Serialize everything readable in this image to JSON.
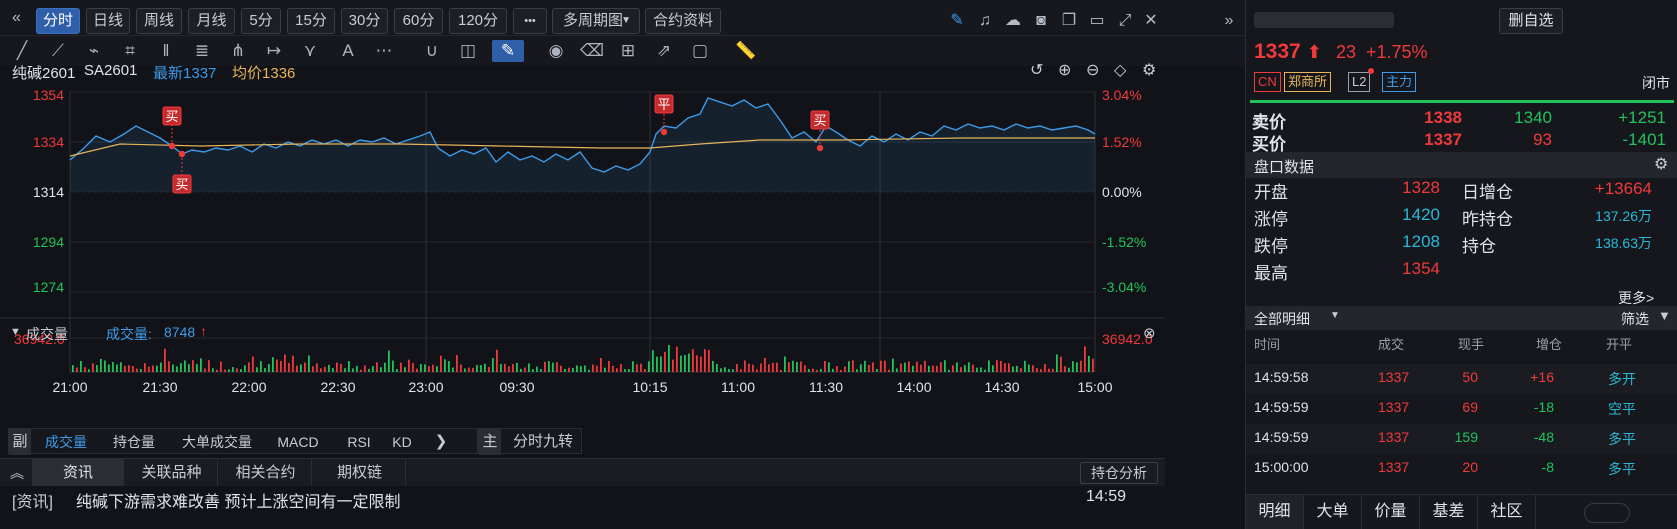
{
  "toolbar": {
    "periods": [
      {
        "label": "分时",
        "active": true
      },
      {
        "label": "日线",
        "active": false
      },
      {
        "label": "周线",
        "active": false
      },
      {
        "label": "月线",
        "active": false
      },
      {
        "label": "5分",
        "active": false
      },
      {
        "label": "15分",
        "active": false
      },
      {
        "label": "30分",
        "active": false
      },
      {
        "label": "60分",
        "active": false
      },
      {
        "label": "120分",
        "active": false
      }
    ],
    "more": "•••",
    "multi_period": "多周期图",
    "contract_info": "合约资料"
  },
  "info": {
    "name": "纯碱2601",
    "code": "SA2601",
    "latest_label": "最新",
    "latest": "1337",
    "avg_label": "均价",
    "avg": "1336"
  },
  "chart": {
    "price_ticks": [
      "1354",
      "1334",
      "1314",
      "1294",
      "1274"
    ],
    "pct_ticks": [
      "3.04%",
      "1.52%",
      "0.00%",
      "-1.52%",
      "-3.04%"
    ],
    "time_labels": [
      "21:00",
      "21:30",
      "22:00",
      "22:30",
      "23:00",
      "09:30",
      "10:15",
      "11:00",
      "11:30",
      "14:00",
      "14:30",
      "15:00"
    ],
    "markers": [
      {
        "label": "买"
      },
      {
        "label": "买"
      },
      {
        "label": "平"
      },
      {
        "label": "买"
      }
    ],
    "colors": {
      "price": "#3d9be9",
      "avg": "#e8b45a",
      "up": "#f0393b",
      "down": "#21c35b"
    }
  },
  "volume": {
    "title": "成交量",
    "label": "成交量:",
    "value": "8748",
    "max_left": "36942.0",
    "max_right": "36942.0"
  },
  "subtabs": {
    "side_label": "副",
    "items": [
      "成交量",
      "持仓量",
      "大单成交量",
      "MACD",
      "RSI",
      "KD"
    ],
    "main_label": "主",
    "main_item": "分时九转"
  },
  "news": {
    "tabs": [
      "资讯",
      "关联品种",
      "相关合约",
      "期权链"
    ],
    "analysis_btn": "持仓分析",
    "items": [
      {
        "tag": "[资讯]",
        "text": "纯碱下游需求难改善 预计上涨空间有一定限制",
        "time": "14:59"
      }
    ]
  },
  "right": {
    "delete_btn": "删自选",
    "price": "1337",
    "change": "23",
    "change_pct": "+1.75%",
    "badges": [
      "CN",
      "郑商所",
      "L2",
      "主力"
    ],
    "status": "闭市",
    "ask_label": "卖价",
    "ask_price": "1338",
    "ask_vol": "1340",
    "ask_delta": "+1251",
    "bid_label": "买价",
    "bid_price": "1337",
    "bid_vol": "93",
    "bid_delta": "-1401",
    "section_title": "盘口数据",
    "stats": [
      {
        "l1": "开盘",
        "v1": "1328",
        "l2": "日增仓",
        "v2": "+13664"
      },
      {
        "l1": "涨停",
        "v1": "1420",
        "l2": "昨持仓",
        "v2": "137.26万"
      },
      {
        "l1": "跌停",
        "v1": "1208",
        "l2": "持仓",
        "v2": "138.63万"
      },
      {
        "l1": "最高",
        "v1": "1354",
        "l2": "",
        "v2": ""
      }
    ],
    "more": "更多>",
    "detail_title": "全部明细",
    "filter": "筛选",
    "detail_headers": [
      "时间",
      "成交",
      "现手",
      "增仓",
      "开平"
    ],
    "details": [
      {
        "time": "14:59:58",
        "price": "1337",
        "vol": "50",
        "oi": "+16",
        "type": "多开"
      },
      {
        "time": "14:59:59",
        "price": "1337",
        "vol": "69",
        "oi": "-18",
        "type": "空平"
      },
      {
        "time": "14:59:59",
        "price": "1337",
        "vol": "159",
        "oi": "-48",
        "type": "多平"
      },
      {
        "time": "15:00:00",
        "price": "1337",
        "vol": "20",
        "oi": "-8",
        "type": "多平"
      }
    ],
    "bottom_tabs": [
      "明细",
      "大单",
      "价量",
      "基差",
      "社区"
    ]
  }
}
